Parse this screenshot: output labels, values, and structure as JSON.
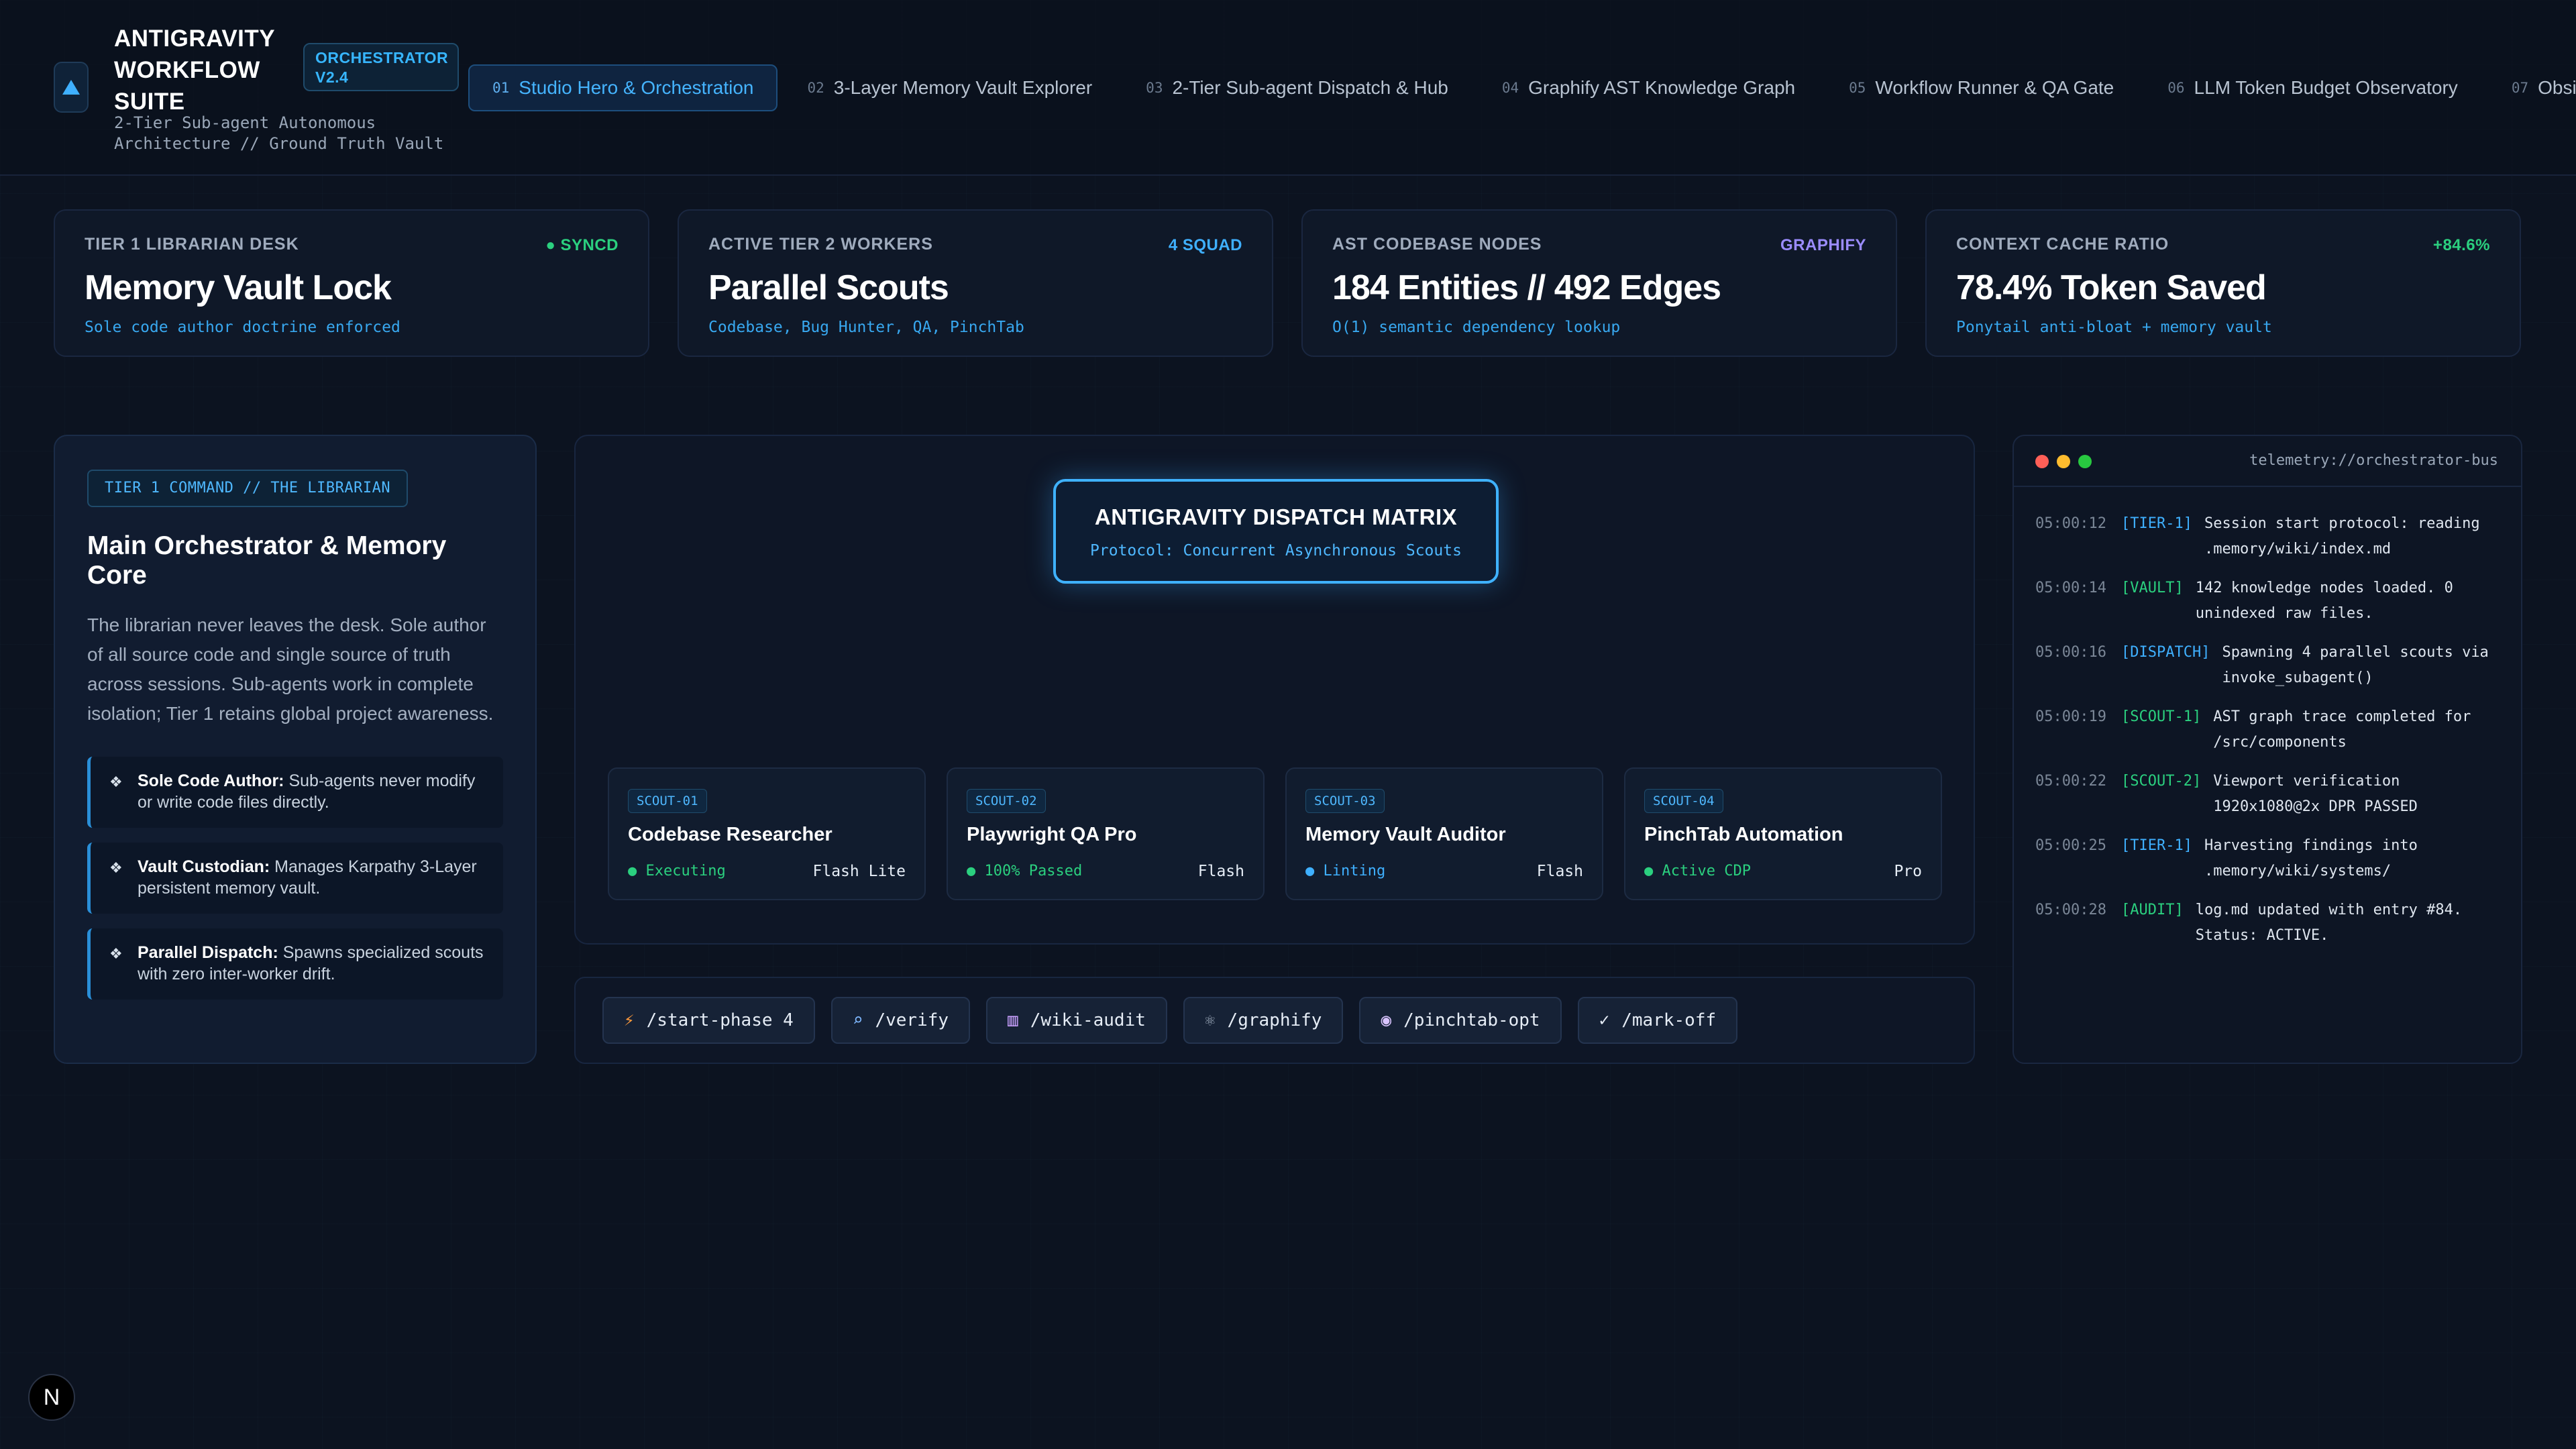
{
  "app": {
    "title": "ANTIGRAVITY WORKFLOW SUITE",
    "version_badge": "ORCHESTRATOR V2.4",
    "subtitle": "2-Tier Sub-agent Autonomous Architecture // Ground Truth Vault",
    "logo_icon": "triangle-up-icon"
  },
  "tabs": [
    {
      "num": "01",
      "label": "Studio Hero & Orchestration",
      "active": true
    },
    {
      "num": "02",
      "label": "3-Layer Memory Vault Explorer"
    },
    {
      "num": "03",
      "label": "2-Tier Sub-agent Dispatch & Hub"
    },
    {
      "num": "04",
      "label": "Graphify AST Knowledge Graph"
    },
    {
      "num": "05",
      "label": "Workflow Runner & QA Gate"
    },
    {
      "num": "06",
      "label": "LLM Token Budget Observatory"
    },
    {
      "num": "07",
      "label": "Obsidian /"
    }
  ],
  "stats": [
    {
      "label": "TIER 1 LIBRARIAN DESK",
      "badge": "● SYNCD",
      "badge_color": "#2bd07f",
      "value": "Memory Vault Lock",
      "sub": "Sole code author doctrine enforced"
    },
    {
      "label": "ACTIVE TIER 2 WORKERS",
      "badge": "4 SQUAD",
      "badge_color": "#3fb0ff",
      "value": "Parallel Scouts",
      "sub": "Codebase, Bug Hunter, QA, PinchTab"
    },
    {
      "label": "AST CODEBASE NODES",
      "badge": "GRAPHIFY",
      "badge_color": "#9b8cff",
      "value": "184 Entities // 492 Edges",
      "sub": "O(1) semantic dependency lookup"
    },
    {
      "label": "CONTEXT CACHE RATIO",
      "badge": "+84.6%",
      "badge_color": "#2bd07f",
      "value": "78.4% Token Saved",
      "sub": "Ponytail anti-bloat + memory vault"
    }
  ],
  "librarian": {
    "tag": "TIER 1 COMMAND // THE LIBRARIAN",
    "title": "Main Orchestrator & Memory Core",
    "description": "The librarian never leaves the desk. Sole author of all source code and single source of truth across sessions. Sub-agents work in complete isolation; Tier 1 retains global project awareness.",
    "items": [
      {
        "bold": "Sole Code Author:",
        "text": " Sub-agents never modify or write code files directly."
      },
      {
        "bold": "Vault Custodian:",
        "text": " Manages Karpathy 3-Layer persistent memory vault."
      },
      {
        "bold": "Parallel Dispatch:",
        "text": " Spawns specialized scouts with zero inter-worker drift."
      }
    ]
  },
  "matrix": {
    "title": "ANTIGRAVITY DISPATCH MATRIX",
    "protocol": "Protocol: Concurrent Asynchronous Scouts",
    "scouts": [
      {
        "id": "SCOUT-01",
        "name": "Codebase Researcher",
        "status": "● Executing",
        "status_color": "#2bd07f",
        "model": "Flash Lite"
      },
      {
        "id": "SCOUT-02",
        "name": "Playwright QA Pro",
        "status": "● 100% Passed",
        "status_color": "#2bd07f",
        "model": "Flash"
      },
      {
        "id": "SCOUT-03",
        "name": "Memory Vault Auditor",
        "status": "● Linting",
        "status_color": "#3fb0ff",
        "model": "Flash"
      },
      {
        "id": "SCOUT-04",
        "name": "PinchTab Automation",
        "status": "● Active CDP",
        "status_color": "#2bd07f",
        "model": "Pro"
      }
    ]
  },
  "commands": [
    {
      "icon": "⚡",
      "icon_name": "lightning-icon",
      "icon_color": "#ff9a3c",
      "label": "/start-phase 4"
    },
    {
      "icon": "🔍",
      "icon_name": "search-icon",
      "icon_color": "#7fb8ff",
      "label": "/verify"
    },
    {
      "icon": "📚",
      "icon_name": "books-icon",
      "icon_color": "#c9a0ff",
      "label": "/wiki-audit"
    },
    {
      "icon": "⚛",
      "icon_name": "atom-icon",
      "icon_color": "#9aa7b8",
      "label": "/graphify"
    },
    {
      "icon": "🤖",
      "icon_name": "robot-icon",
      "icon_color": "#d9c4ff",
      "label": "/pinchtab-opt"
    },
    {
      "icon": "✓",
      "icon_name": "check-icon",
      "icon_color": "#e6edf6",
      "label": "/mark-off"
    }
  ],
  "terminal": {
    "title": "telemetry://orchestrator-bus",
    "logs": [
      {
        "time": "05:00:12",
        "tag": "[TIER-1]",
        "msg": "Session start protocol: reading .memory/wiki/index.md"
      },
      {
        "time": "05:00:14",
        "tag": "[VAULT]",
        "msg": "142 knowledge nodes loaded. 0 unindexed raw files."
      },
      {
        "time": "05:00:16",
        "tag": "[DISPATCH]",
        "msg": "Spawning 4 parallel scouts via invoke_subagent()"
      },
      {
        "time": "05:00:19",
        "tag": "[SCOUT-1]",
        "msg": "AST graph trace completed for /src/components"
      },
      {
        "time": "05:00:22",
        "tag": "[SCOUT-2]",
        "msg": "Viewport verification 1920x1080@2x DPR PASSED"
      },
      {
        "time": "05:00:25",
        "tag": "[TIER-1]",
        "msg": "Harvesting findings into .memory/wiki/systems/"
      },
      {
        "time": "05:00:28",
        "tag": "[AUDIT]",
        "msg": "log.md updated with entry #84. Status: ACTIVE."
      }
    ]
  },
  "corner_button": {
    "label": "N",
    "icon_name": "n-logo-icon"
  },
  "colors": {
    "accent": "#3fb0ff",
    "success": "#2bd07f",
    "background": "#0c1320"
  }
}
